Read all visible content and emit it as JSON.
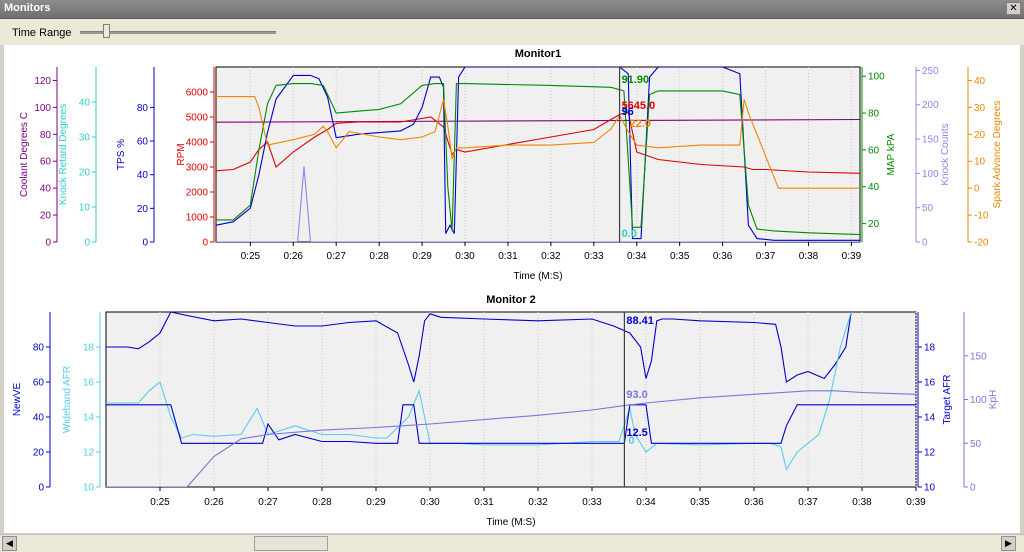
{
  "window": {
    "title": "Monitors",
    "close_glyph": "✕"
  },
  "toolbar": {
    "time_range_label": "Time Range",
    "slider_value": 0.12
  },
  "scrollbar": {
    "left_glyph": "◀",
    "right_glyph": "▶",
    "thumb_position": 0.26
  },
  "chart_data": [
    {
      "type": "line",
      "title": "Monitor1",
      "xlabel": "Time (M:S)",
      "x_ticks": [
        "0:25",
        "0:26",
        "0:27",
        "0:28",
        "0:29",
        "0:30",
        "0:31",
        "0:32",
        "0:33",
        "0:34",
        "0:35",
        "0:36",
        "0:37",
        "0:38",
        "0:39"
      ],
      "x_range": [
        24.2,
        39.2
      ],
      "cursor_x": 33.6,
      "grid": true,
      "left_axes": [
        {
          "name": "Coolant Degrees C",
          "color": "#800080",
          "ylim": [
            0,
            130
          ],
          "ticks": [
            0,
            20,
            40,
            60,
            80,
            100,
            120
          ]
        },
        {
          "name": "Knock Retard Degrees",
          "color": "#33cccc",
          "ylim": [
            0,
            50
          ],
          "ticks": [
            0,
            10,
            20,
            30,
            40
          ]
        },
        {
          "name": "TPS %",
          "color": "#0000cc",
          "ylim": [
            0,
            104
          ],
          "ticks": [
            0,
            20,
            40,
            60,
            80
          ]
        },
        {
          "name": "RPM",
          "color": "#dd0000",
          "ylim": [
            0,
            7000
          ],
          "ticks": [
            0,
            1000,
            2000,
            3000,
            4000,
            5000,
            6000
          ]
        }
      ],
      "right_axes": [
        {
          "name": "MAP kPA",
          "color": "#008800",
          "ylim": [
            10,
            105
          ],
          "ticks": [
            20,
            40,
            60,
            80,
            100
          ]
        },
        {
          "name": "Knock Counts",
          "color": "#8888ee",
          "ylim": [
            0,
            255
          ],
          "ticks": [
            0,
            50,
            100,
            150,
            200,
            250
          ]
        },
        {
          "name": "Spark Advance Degrees",
          "color": "#ee8800",
          "ylim": [
            -20,
            45
          ],
          "ticks": [
            -20,
            -10,
            0,
            10,
            20,
            30,
            40
          ]
        }
      ],
      "cursor_labels": [
        {
          "text": "91.90",
          "color": "#008800"
        },
        {
          "text": "5645.0",
          "color": "#dd0000"
        },
        {
          "text": "96",
          "color": "#0000cc"
        },
        {
          "text": "22.0",
          "color": "#ee8800"
        },
        {
          "text": "0.0",
          "color": "#33cccc"
        }
      ],
      "series": [
        {
          "axis": "Coolant Degrees C",
          "color": "#800080",
          "x": [
            24.2,
            39.2
          ],
          "values": [
            89,
            91
          ]
        },
        {
          "axis": "RPM",
          "color": "#dd0000",
          "x": [
            24.2,
            24.6,
            25.0,
            25.2,
            25.4,
            25.6,
            26.0,
            26.5,
            26.8,
            27.0,
            27.5,
            28.5,
            29.2,
            29.5,
            29.7,
            29.8,
            30.0,
            31.0,
            32.0,
            33.0,
            33.4,
            33.6,
            33.8,
            34.0,
            34.5,
            35.5,
            36.5,
            36.7,
            37.0,
            38.0,
            39.2
          ],
          "values": [
            2850,
            2900,
            3200,
            3700,
            4000,
            3000,
            3600,
            4200,
            4500,
            4750,
            4800,
            4800,
            5000,
            4600,
            3500,
            3700,
            3600,
            3900,
            4200,
            4500,
            4900,
            5100,
            5200,
            3600,
            3300,
            3100,
            3000,
            2900,
            2900,
            2800,
            2750
          ]
        },
        {
          "axis": "TPS %",
          "color": "#0000cc",
          "x": [
            24.2,
            24.6,
            25.0,
            25.2,
            25.4,
            25.6,
            26.0,
            26.4,
            26.6,
            26.8,
            27.0,
            27.5,
            28.0,
            28.5,
            28.8,
            29.0,
            29.2,
            29.4,
            29.5,
            29.55,
            29.65,
            29.75,
            29.85,
            30.0,
            32.0,
            33.6,
            33.8,
            33.9,
            34.1,
            34.3,
            34.5,
            36.0,
            36.4,
            36.6,
            36.8,
            37.2,
            38.0,
            39.2
          ],
          "values": [
            10,
            12,
            20,
            40,
            65,
            85,
            99,
            99,
            97,
            86,
            62,
            64,
            65,
            66,
            70,
            80,
            98,
            98,
            92,
            5,
            10,
            5,
            98,
            104,
            104,
            104,
            100,
            2,
            2,
            98,
            104,
            104,
            100,
            10,
            2,
            1,
            1,
            1
          ]
        },
        {
          "axis": "MAP kPA",
          "color": "#008800",
          "x": [
            24.2,
            24.6,
            25.0,
            25.2,
            25.4,
            25.6,
            26.0,
            26.4,
            26.7,
            27.0,
            27.5,
            28.0,
            28.5,
            29.0,
            29.3,
            29.5,
            29.6,
            29.7,
            29.8,
            30.0,
            32.0,
            33.4,
            33.7,
            33.9,
            34.1,
            34.3,
            34.5,
            36.0,
            36.4,
            36.6,
            36.8,
            37.2,
            38.0,
            39.2
          ],
          "values": [
            22,
            22,
            30,
            60,
            85,
            95,
            96,
            96,
            95,
            80,
            81,
            82,
            85,
            95,
            96,
            96,
            40,
            16,
            96,
            96,
            95,
            94,
            92,
            18,
            18,
            90,
            92,
            92,
            90,
            30,
            17,
            16,
            15,
            14
          ]
        },
        {
          "axis": "Knock Counts",
          "color": "#8888ee",
          "x": [
            24.2,
            26.0,
            26.1,
            26.25,
            26.4,
            26.5,
            39.2
          ],
          "values": [
            0,
            0,
            0,
            110,
            0,
            0,
            0
          ]
        },
        {
          "axis": "Spark Advance Degrees",
          "color": "#ee8800",
          "x": [
            24.2,
            25.0,
            25.1,
            25.2,
            25.4,
            26.0,
            26.5,
            26.7,
            26.8,
            27.0,
            27.3,
            28.0,
            28.5,
            29.0,
            29.3,
            29.4,
            29.5,
            29.6,
            29.7,
            29.8,
            30.0,
            31.0,
            32.0,
            33.0,
            33.4,
            33.6,
            33.8,
            34.0,
            34.5,
            35.5,
            36.4,
            36.5,
            36.6,
            37.0,
            37.3,
            38.0,
            39.2
          ],
          "values": [
            34,
            34,
            34,
            30,
            16,
            18,
            20,
            23,
            21,
            15,
            21,
            19,
            18,
            19,
            21,
            27,
            33,
            23,
            11,
            15,
            15,
            16,
            16,
            17,
            22,
            27,
            21,
            16,
            15,
            16,
            16,
            33,
            28,
            12,
            0,
            0,
            0
          ]
        }
      ]
    },
    {
      "type": "line",
      "title": "Monitor 2",
      "xlabel": "Time (M:S)",
      "x_ticks": [
        "0:25",
        "0:26",
        "0:27",
        "0:28",
        "0:29",
        "0:30",
        "0:31",
        "0:32",
        "0:33",
        "0:34",
        "0:35",
        "0:36",
        "0:37",
        "0:38",
        "0:39"
      ],
      "x_range": [
        24.0,
        39.0
      ],
      "cursor_x": 33.6,
      "grid": true,
      "left_axes": [
        {
          "name": "NewVE",
          "color": "#0000cc",
          "ylim": [
            0,
            100
          ],
          "ticks": [
            0,
            20,
            40,
            60,
            80
          ]
        },
        {
          "name": "Wideband AFR",
          "color": "#55ccee",
          "ylim": [
            10,
            20
          ],
          "ticks": [
            10,
            12,
            14,
            16,
            18
          ]
        }
      ],
      "right_axes": [
        {
          "name": "Target AFR",
          "color": "#0000cc",
          "ylim": [
            10,
            20
          ],
          "ticks": [
            10,
            12,
            14,
            16,
            18
          ]
        },
        {
          "name": "KpH",
          "color": "#7777dd",
          "ylim": [
            0,
            200
          ],
          "ticks": [
            0,
            50,
            100,
            150
          ]
        }
      ],
      "cursor_labels": [
        {
          "text": "88.41",
          "color": "#0000cc"
        },
        {
          "text": "93.0",
          "color": "#7777dd"
        },
        {
          "text": "12.5",
          "color": "#0000cc"
        },
        {
          "text": "0",
          "color": "#55ccee"
        }
      ],
      "series": [
        {
          "axis": "NewVE",
          "color": "#0000cc",
          "x": [
            24.0,
            24.4,
            24.6,
            24.8,
            25.0,
            25.2,
            25.5,
            26.0,
            26.5,
            27.0,
            27.5,
            28.0,
            28.5,
            29.0,
            29.4,
            29.6,
            29.7,
            29.8,
            29.9,
            30.0,
            30.2,
            31.0,
            32.0,
            33.0,
            33.4,
            33.7,
            33.9,
            34.0,
            34.1,
            34.2,
            34.3,
            34.5,
            35.0,
            36.0,
            36.4,
            36.5,
            36.6,
            36.8,
            37.0,
            37.3,
            37.5,
            37.7,
            37.8
          ],
          "values": [
            80,
            80,
            79,
            83,
            88,
            100,
            98,
            95,
            96,
            94,
            92,
            92,
            94,
            95,
            88,
            70,
            60,
            75,
            95,
            99,
            97,
            96,
            95,
            96,
            92,
            88,
            80,
            62,
            72,
            95,
            96,
            96,
            95,
            94,
            93,
            80,
            60,
            64,
            66,
            62,
            70,
            80,
            100
          ]
        },
        {
          "axis": "Wideband AFR",
          "color": "#55ccee",
          "x": [
            24.0,
            24.6,
            24.8,
            25.0,
            25.2,
            25.4,
            25.6,
            26.0,
            26.5,
            26.8,
            27.0,
            27.5,
            28.0,
            28.5,
            29.0,
            29.2,
            29.6,
            29.8,
            30.0,
            30.5,
            31.0,
            32.0,
            33.0,
            33.5,
            33.7,
            33.8,
            34.0,
            34.2,
            35.0,
            36.0,
            36.3,
            36.5,
            36.6,
            36.8,
            37.0,
            37.2,
            37.4,
            37.6,
            37.8
          ],
          "values": [
            14.8,
            14.8,
            15.5,
            16,
            14,
            12.8,
            13,
            12.9,
            13,
            14.5,
            13,
            13.5,
            13,
            13,
            12.8,
            12.8,
            14,
            15.5,
            12.5,
            12.5,
            12.4,
            12.4,
            12.6,
            12.6,
            14.5,
            13,
            12,
            12.5,
            12.4,
            12.5,
            12.5,
            12.3,
            11,
            12,
            12.5,
            13,
            15,
            18,
            20
          ]
        },
        {
          "axis": "Target AFR",
          "color": "#0000cc",
          "x": [
            24.0,
            25.0,
            25.2,
            25.4,
            26.0,
            26.5,
            26.9,
            27.0,
            27.2,
            27.5,
            28.0,
            28.5,
            29.0,
            29.4,
            29.5,
            29.7,
            29.8,
            30.0,
            31.0,
            32.0,
            33.0,
            33.6,
            33.7,
            34.0,
            34.1,
            35.0,
            36.0,
            36.5,
            36.6,
            36.8,
            37.0,
            39.0
          ],
          "values": [
            14.7,
            14.7,
            14.7,
            12.5,
            12.5,
            12.5,
            12.5,
            13.6,
            12.7,
            13,
            12.6,
            12.6,
            12.5,
            12.5,
            14.7,
            14.7,
            12.5,
            12.5,
            12.5,
            12.5,
            12.5,
            12.5,
            14.7,
            14.7,
            12.5,
            12.5,
            12.5,
            12.5,
            13.5,
            14.7,
            14.7,
            14.7
          ]
        },
        {
          "axis": "KpH",
          "color": "#7777dd",
          "x": [
            24.0,
            25.5,
            26.0,
            26.5,
            27.0,
            28.0,
            29.0,
            30.0,
            31.0,
            32.0,
            33.0,
            33.6,
            34.0,
            35.0,
            36.0,
            37.0,
            37.5,
            38.0,
            39.0
          ],
          "values": [
            0,
            0,
            35,
            55,
            60,
            65,
            68,
            72,
            77,
            82,
            88,
            93,
            96,
            102,
            106,
            110,
            110,
            108,
            106
          ]
        }
      ]
    }
  ]
}
